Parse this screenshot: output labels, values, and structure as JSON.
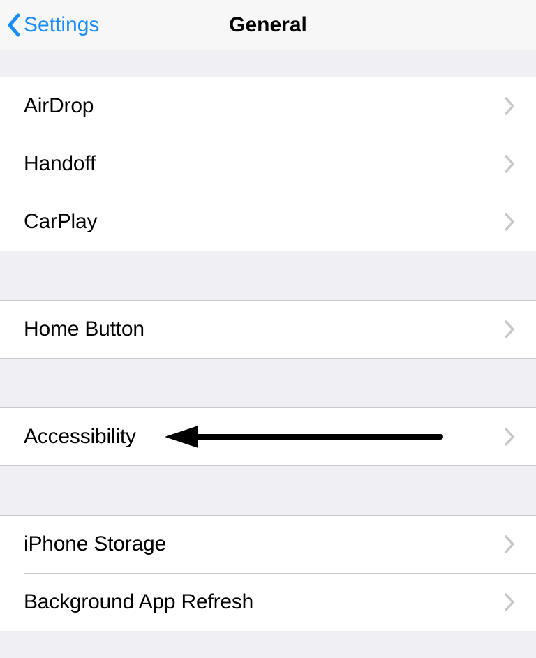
{
  "navbar": {
    "back_label": "Settings",
    "title": "General"
  },
  "groups": [
    {
      "items": [
        {
          "label": "AirDrop"
        },
        {
          "label": "Handoff"
        },
        {
          "label": "CarPlay"
        }
      ]
    },
    {
      "items": [
        {
          "label": "Home Button"
        }
      ]
    },
    {
      "items": [
        {
          "label": "Accessibility"
        }
      ]
    },
    {
      "items": [
        {
          "label": "iPhone Storage"
        },
        {
          "label": "Background App Refresh"
        }
      ]
    }
  ]
}
